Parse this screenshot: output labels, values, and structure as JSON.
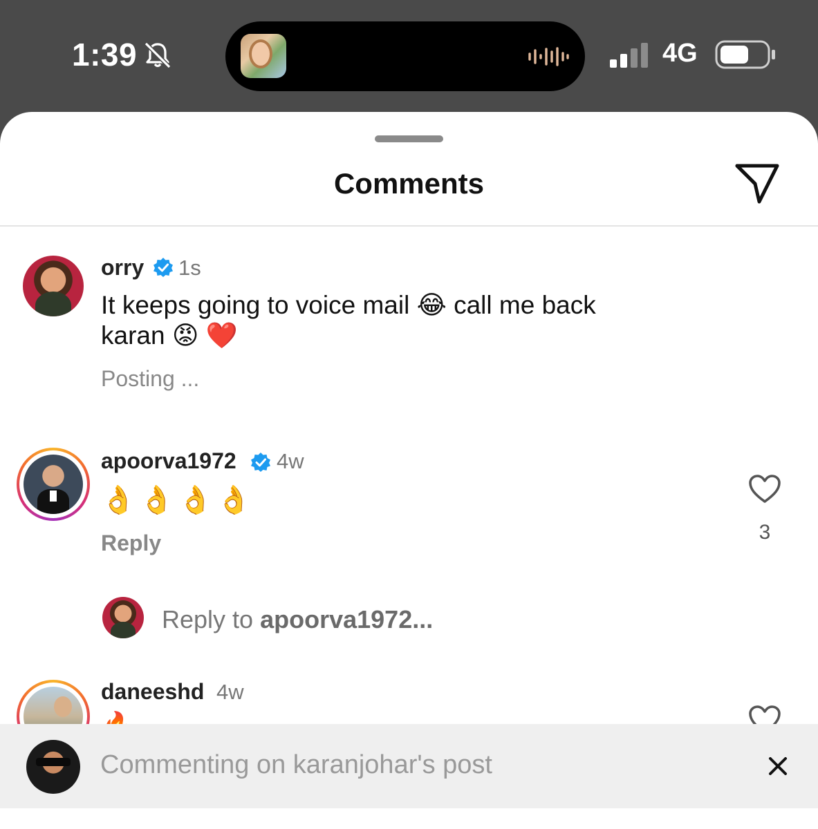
{
  "status_bar": {
    "time": "1:39",
    "network": "4G",
    "icons": [
      "bell-slash-icon",
      "audio-wave-icon",
      "signal-icon",
      "battery-icon"
    ]
  },
  "sheet": {
    "title": "Comments",
    "send_icon": "paper-plane-icon"
  },
  "comments": [
    {
      "username": "orry",
      "verified": true,
      "age": "1s",
      "text_line1": "It keeps going to voice mail 😂 call me back",
      "text_line2": "karan 😡 ❤️",
      "status": "Posting ..."
    },
    {
      "username": "apoorva1972",
      "verified": true,
      "age": "4w",
      "text": "👌👌👌👌",
      "reply_label": "Reply",
      "likes": "3"
    },
    {
      "username": "daneeshd",
      "verified": false,
      "age": "4w",
      "text": "🔥"
    }
  ],
  "reply_composer": {
    "prefix": "Reply to ",
    "target": "apoorva1972..."
  },
  "footer": {
    "placeholder": "Commenting on karanjohar's post",
    "close_icon": "close-icon"
  },
  "colors": {
    "status_bg": "#4a4a4a",
    "verified": "#1d9bf0",
    "footer_bg": "#efefef"
  }
}
